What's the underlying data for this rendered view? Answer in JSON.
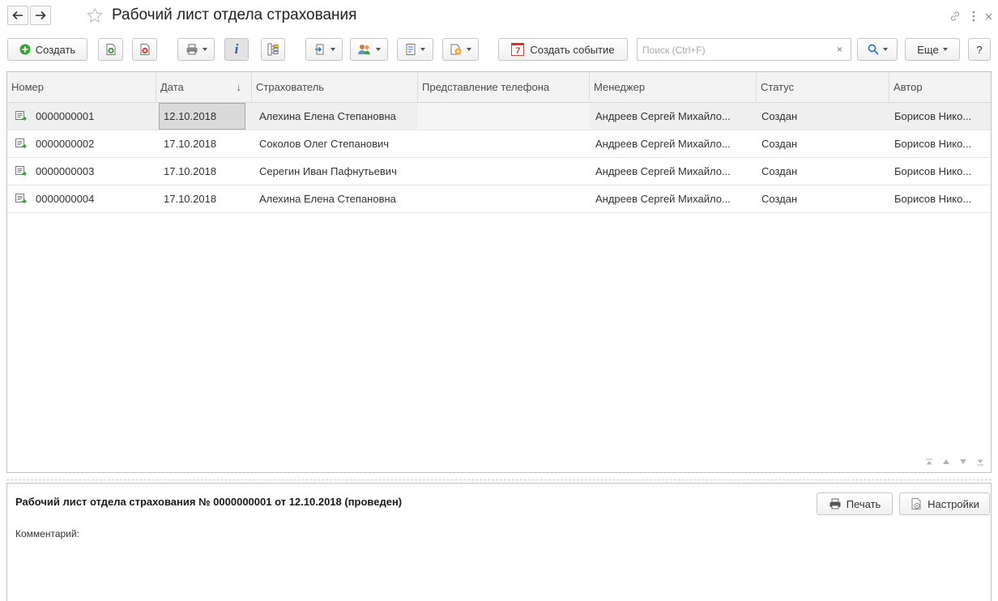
{
  "window": {
    "title": "Рабочий лист отдела страхования",
    "star_icon": "star-icon",
    "link_icon": "link-icon",
    "more_icon": "more-vertical-icon",
    "close_icon": "close-icon"
  },
  "toolbar": {
    "create_label": "Создать",
    "create_event_label": "Создать событие",
    "event_icon_text": "7",
    "search_placeholder": "Поиск (Ctrl+F)",
    "search_clear": "×",
    "more_label": "Еще",
    "help_label": "?"
  },
  "table": {
    "columns": [
      "Номер",
      "Дата",
      "Страхователь",
      "Представление телефона",
      "Менеджер",
      "Статус",
      "Автор"
    ],
    "sorted_column": "Дата",
    "sort_arrow": "↓",
    "rows": [
      {
        "number": "0000000001",
        "date": "12.10.2018",
        "insured": "Алехина Елена Степановна",
        "phone": "",
        "manager": "Андреев Сергей Михайло...",
        "status": "Создан",
        "author": "Борисов Нико..."
      },
      {
        "number": "0000000002",
        "date": "17.10.2018",
        "insured": "Соколов Олег Степанович",
        "phone": "",
        "manager": "Андреев Сергей Михайло...",
        "status": "Создан",
        "author": "Борисов Нико..."
      },
      {
        "number": "0000000003",
        "date": "17.10.2018",
        "insured": "Серегин Иван Пафнутьевич",
        "phone": "",
        "manager": "Андреев Сергей Михайло...",
        "status": "Создан",
        "author": "Борисов Нико..."
      },
      {
        "number": "0000000004",
        "date": "17.10.2018",
        "insured": "Алехина Елена Степановна",
        "phone": "",
        "manager": "Андреев Сергей Михайло...",
        "status": "Создан",
        "author": "Борисов Нико..."
      }
    ],
    "selected_row": 0
  },
  "preview": {
    "title": "Рабочий лист отдела страхования № 0000000001 от 12.10.2018 (проведен)",
    "comment_label": "Комментарий:",
    "print_label": "Печать",
    "settings_label": "Настройки"
  },
  "colors": {
    "accent_green": "#3aa335",
    "accent_red": "#d9302c",
    "selected_row": "#efefef",
    "current_cell": "#dadada"
  }
}
